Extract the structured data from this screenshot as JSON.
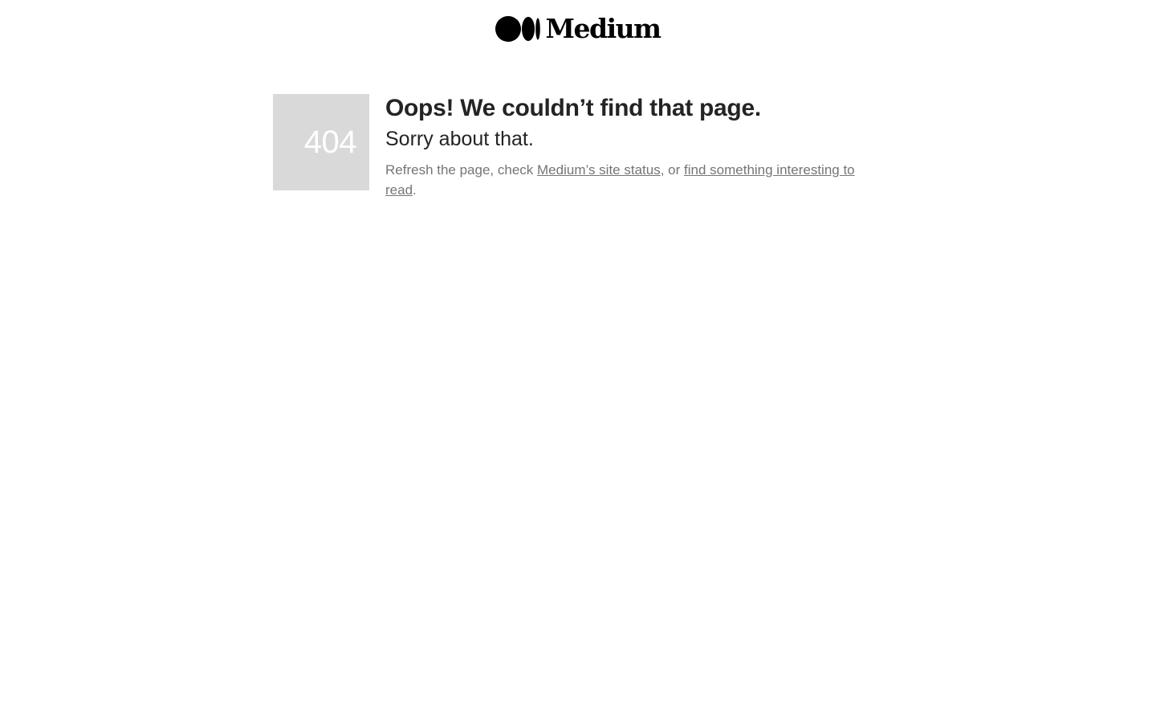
{
  "header": {
    "logo_text": "Medium",
    "logo_icon": "medium-logo-mark"
  },
  "error": {
    "code": "404",
    "title": "Oops! We couldn’t find that page.",
    "subtitle": "Sorry about that.",
    "message_prefix": "Refresh the page, check ",
    "status_link": "Medium’s site status",
    "message_middle": ", or ",
    "read_link": "find something interesting to read",
    "message_suffix": "."
  },
  "colors": {
    "code_box_background": "#d9d9d9",
    "code_text": "#ffffff",
    "heading_text": "#242424",
    "body_text": "#757575"
  }
}
